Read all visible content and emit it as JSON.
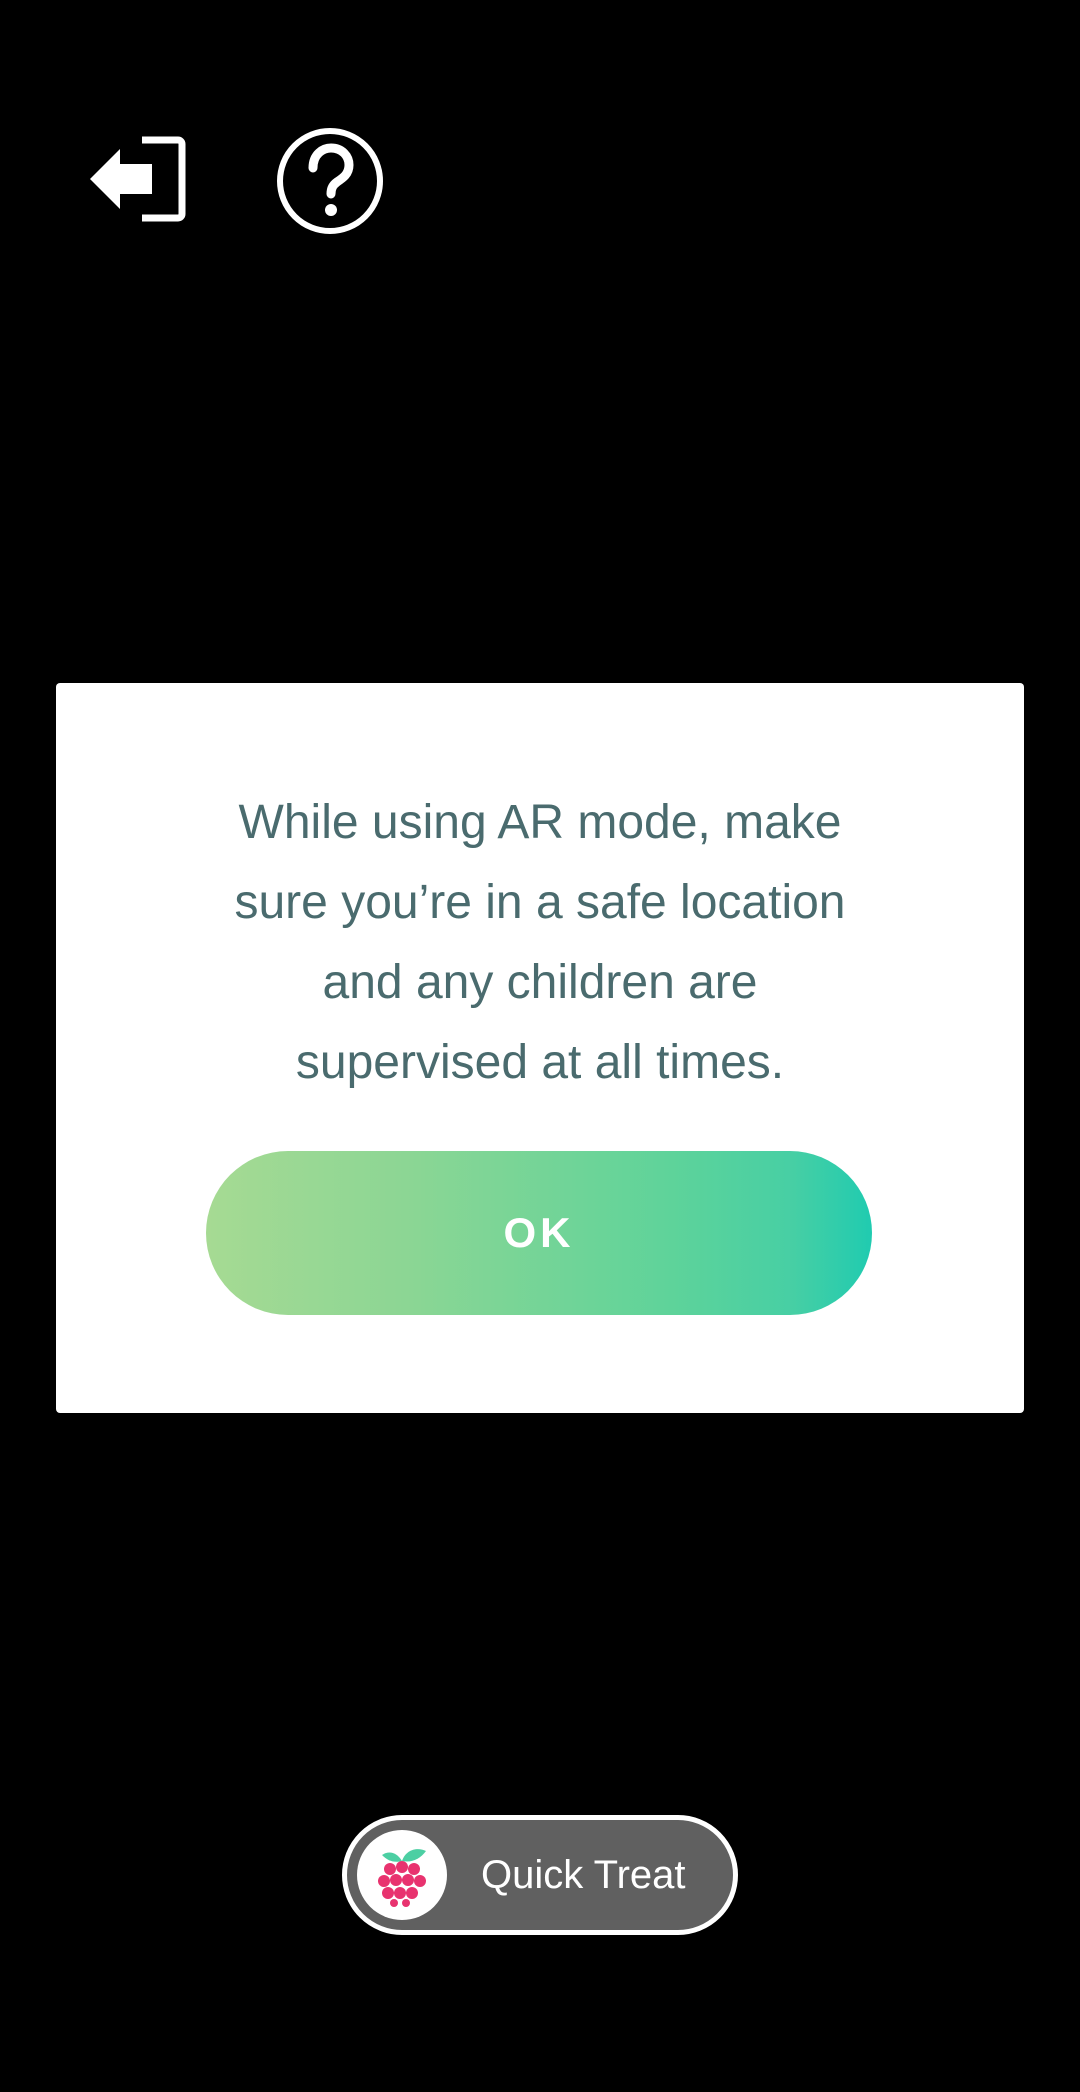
{
  "top_bar": {
    "exit_icon": "exit-door-arrow-icon",
    "help_icon": "question-circle-icon"
  },
  "dialog": {
    "message": "While using AR mode, make sure you’re in a safe location and any children are supervised at all times.",
    "ok_label": "OK",
    "text_color": "#4a6b6e",
    "button_gradient": [
      "#a6da93",
      "#20cbb0"
    ]
  },
  "quick_treat": {
    "label": "Quick Treat",
    "icon": "raspberry-icon",
    "berry_color": "#e8336f",
    "leaf_color": "#4ccfa3"
  }
}
